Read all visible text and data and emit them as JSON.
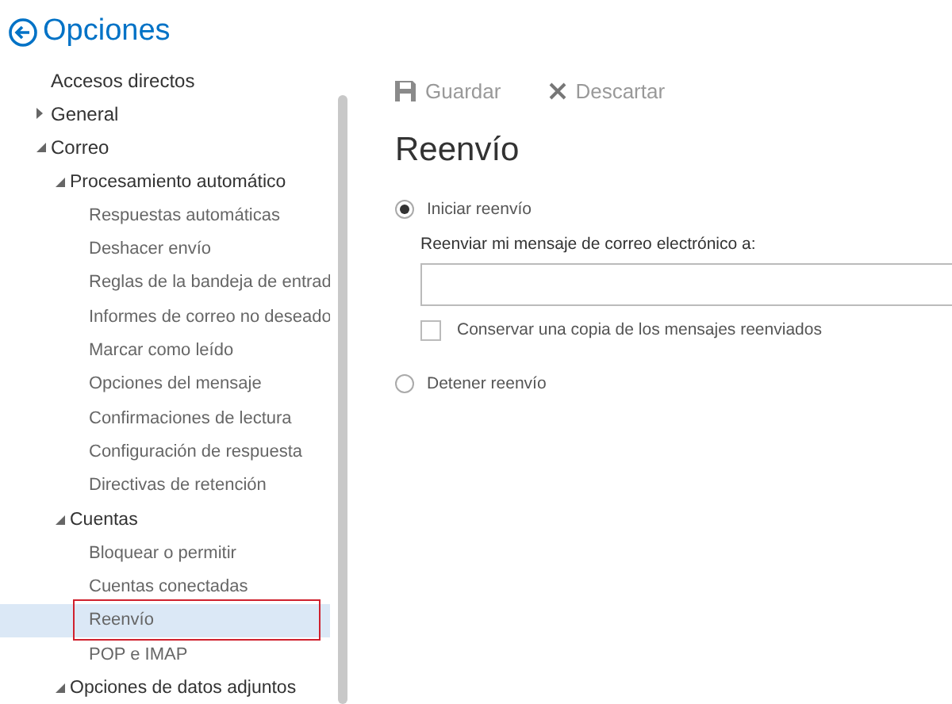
{
  "header": {
    "title": "Opciones"
  },
  "nav": [
    {
      "label": "Accesos directos",
      "selected": false
    },
    {
      "label": "General",
      "expanded": false,
      "selected": false
    },
    {
      "label": "Correo",
      "expanded": true,
      "selected": false,
      "children": [
        {
          "label": "Procesamiento automático",
          "expanded": true,
          "selected": false,
          "children": [
            {
              "label": "Respuestas automáticas",
              "selected": false
            },
            {
              "label": "Deshacer envío",
              "selected": false
            },
            {
              "label": "Reglas de la bandeja de entrad",
              "selected": false
            },
            {
              "label": "Informes de correo no deseado",
              "selected": false
            },
            {
              "label": "Marcar como leído",
              "selected": false
            },
            {
              "label": "Opciones del mensaje",
              "selected": false
            },
            {
              "label": "Confirmaciones de lectura",
              "selected": false
            },
            {
              "label": "Configuración de respuesta",
              "selected": false
            },
            {
              "label": "Directivas de retención",
              "selected": false
            }
          ]
        },
        {
          "label": "Cuentas",
          "expanded": true,
          "selected": false,
          "children": [
            {
              "label": "Bloquear o permitir",
              "selected": false
            },
            {
              "label": "Cuentas conectadas",
              "selected": false
            },
            {
              "label": "Reenvío",
              "selected": true
            },
            {
              "label": "POP e IMAP",
              "selected": false
            }
          ]
        },
        {
          "label": "Opciones de datos adjuntos",
          "expanded": true,
          "selected": false
        }
      ]
    }
  ],
  "toolbar": [
    {
      "kind": "save",
      "label": "Guardar"
    },
    {
      "kind": "discard",
      "label": "Descartar"
    }
  ],
  "page": {
    "title": "Reenvío",
    "start_option": {
      "label": "Iniciar reenvío",
      "selected": true
    },
    "address_label": "Reenviar mi mensaje de correo electrónico a:",
    "keep_copy": {
      "label": "Conservar una copia de los mensajes reenviados",
      "checked": false
    },
    "stop_option": {
      "label": "Detener reenvío",
      "selected": false
    }
  }
}
